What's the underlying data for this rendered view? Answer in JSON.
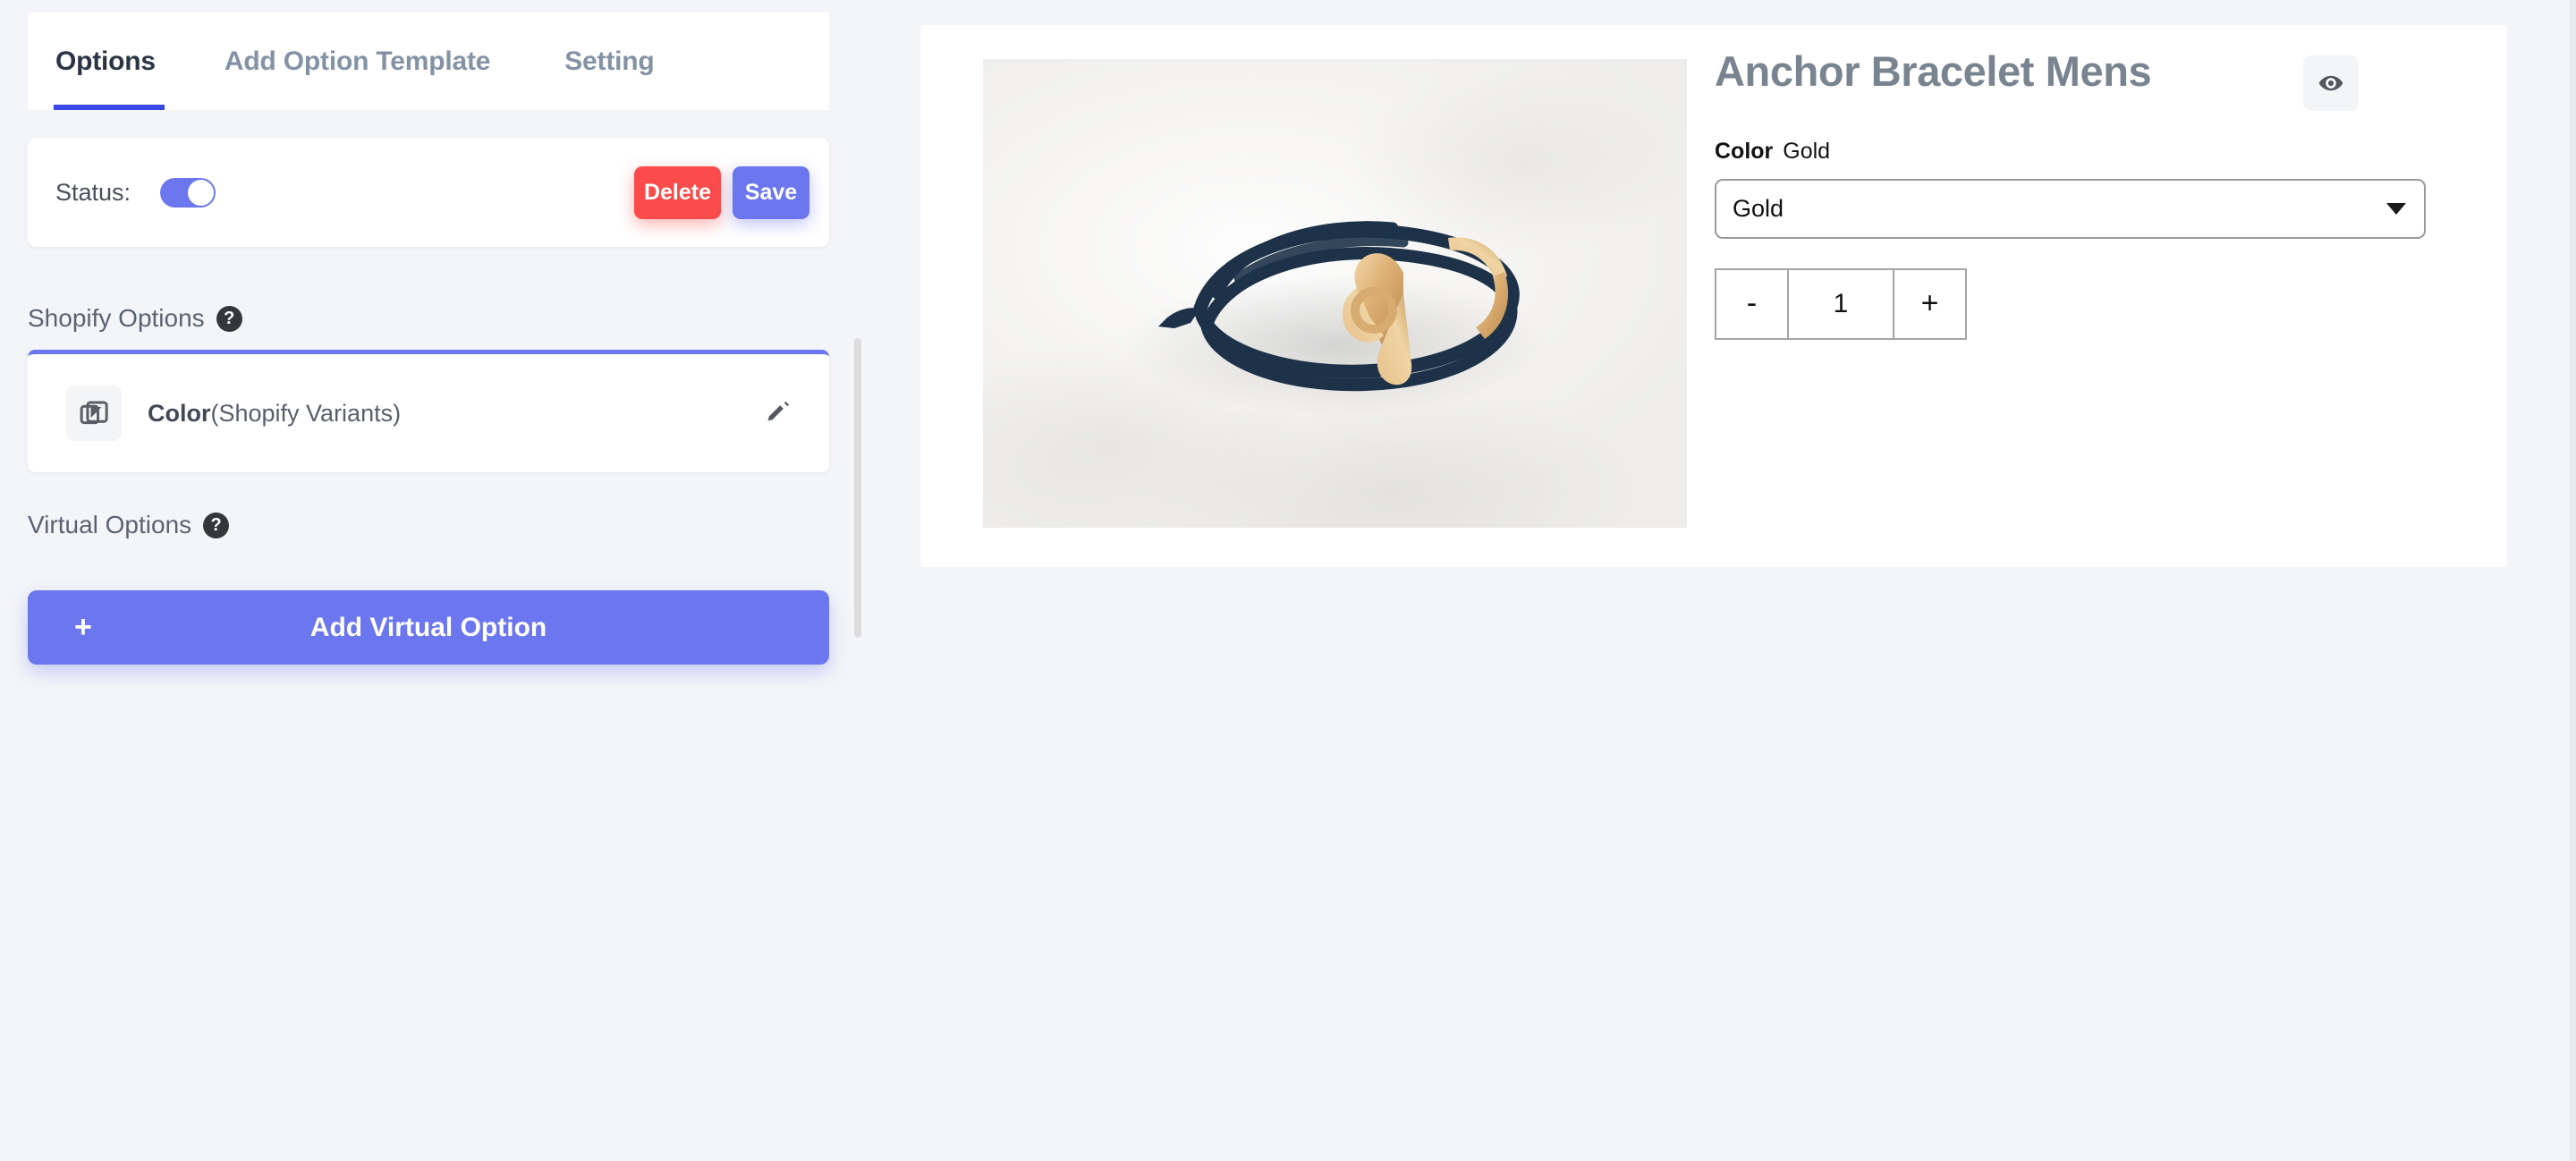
{
  "tabs": [
    {
      "label": "Options",
      "active": true
    },
    {
      "label": "Add Option Template",
      "active": false
    },
    {
      "label": "Setting",
      "active": false
    }
  ],
  "status_card": {
    "label": "Status:",
    "toggle_on": true,
    "delete_label": "Delete",
    "save_label": "Save"
  },
  "shopify_section": {
    "title": "Shopify Options",
    "help_glyph": "?",
    "option": {
      "name": "Color",
      "suffix": "(Shopify Variants)",
      "icon": "variant-icon",
      "edit_icon": "pencil-icon"
    }
  },
  "virtual_section": {
    "title": "Virtual Options",
    "help_glyph": "?",
    "add_button_label": "Add Virtual Option",
    "add_button_plus": "+"
  },
  "preview": {
    "product_title": "Anchor Bracelet Mens",
    "preview_icon": "eye-icon",
    "option_label": "Color",
    "option_value": "Gold",
    "select_value": "Gold",
    "quantity": {
      "decrement": "-",
      "value": "1",
      "increment": "+"
    },
    "image_alt": "anchor-bracelet-product-photo"
  },
  "colors": {
    "accent": "#6c77ef",
    "tab_underline": "#3b46e8",
    "danger": "#fb4b4b",
    "page_background": "#f4f5f9",
    "title_text": "#7a8490"
  }
}
